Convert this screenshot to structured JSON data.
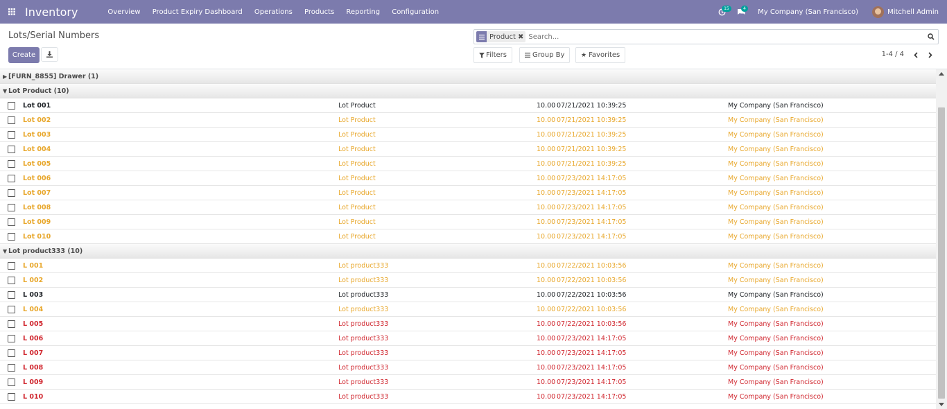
{
  "navbar": {
    "app_title": "Inventory",
    "menu": [
      "Overview",
      "Product Expiry Dashboard",
      "Operations",
      "Products",
      "Reporting",
      "Configuration"
    ],
    "activity_count": "15",
    "messages_count": "4",
    "company": "My Company (San Francisco)",
    "user": "Mitchell Admin"
  },
  "control": {
    "breadcrumb": "Lots/Serial Numbers",
    "create_label": "Create",
    "search_facet": "Product",
    "search_placeholder": "Search...",
    "filters_label": "Filters",
    "groupby_label": "Group By",
    "favorites_label": "Favorites",
    "pager": "1-4 / 4"
  },
  "groups": [
    {
      "label": "[FURN_8855] Drawer (1)",
      "expanded": false
    },
    {
      "label": "Lot Product (10)",
      "expanded": true
    },
    {
      "label": "Lot product333 (10)",
      "expanded": true
    }
  ],
  "group1_rows": [
    {
      "lot": "Lot 001",
      "product": "Lot Product",
      "qty": "10.00",
      "date": "07/21/2021 10:39:25",
      "company": "My Company (San Francisco)",
      "status": "black"
    },
    {
      "lot": "Lot 002",
      "product": "Lot Product",
      "qty": "10.00",
      "date": "07/21/2021 10:39:25",
      "company": "My Company (San Francisco)",
      "status": "orange"
    },
    {
      "lot": "Lot 003",
      "product": "Lot Product",
      "qty": "10.00",
      "date": "07/21/2021 10:39:25",
      "company": "My Company (San Francisco)",
      "status": "orange"
    },
    {
      "lot": "Lot 004",
      "product": "Lot Product",
      "qty": "10.00",
      "date": "07/21/2021 10:39:25",
      "company": "My Company (San Francisco)",
      "status": "orange"
    },
    {
      "lot": "Lot 005",
      "product": "Lot Product",
      "qty": "10.00",
      "date": "07/21/2021 10:39:25",
      "company": "My Company (San Francisco)",
      "status": "orange"
    },
    {
      "lot": "Lot 006",
      "product": "Lot Product",
      "qty": "10.00",
      "date": "07/23/2021 14:17:05",
      "company": "My Company (San Francisco)",
      "status": "orange"
    },
    {
      "lot": "Lot 007",
      "product": "Lot Product",
      "qty": "10.00",
      "date": "07/23/2021 14:17:05",
      "company": "My Company (San Francisco)",
      "status": "orange"
    },
    {
      "lot": "Lot 008",
      "product": "Lot Product",
      "qty": "10.00",
      "date": "07/23/2021 14:17:05",
      "company": "My Company (San Francisco)",
      "status": "orange"
    },
    {
      "lot": "Lot 009",
      "product": "Lot Product",
      "qty": "10.00",
      "date": "07/23/2021 14:17:05",
      "company": "My Company (San Francisco)",
      "status": "orange"
    },
    {
      "lot": "Lot 010",
      "product": "Lot Product",
      "qty": "10.00",
      "date": "07/23/2021 14:17:05",
      "company": "My Company (San Francisco)",
      "status": "orange"
    }
  ],
  "group2_rows": [
    {
      "lot": "L 001",
      "product": "Lot product333",
      "qty": "10.00",
      "date": "07/22/2021 10:03:56",
      "company": "My Company (San Francisco)",
      "status": "orange"
    },
    {
      "lot": "L 002",
      "product": "Lot product333",
      "qty": "10.00",
      "date": "07/22/2021 10:03:56",
      "company": "My Company (San Francisco)",
      "status": "orange"
    },
    {
      "lot": "L 003",
      "product": "Lot product333",
      "qty": "10.00",
      "date": "07/22/2021 10:03:56",
      "company": "My Company (San Francisco)",
      "status": "black"
    },
    {
      "lot": "L 004",
      "product": "Lot product333",
      "qty": "10.00",
      "date": "07/22/2021 10:03:56",
      "company": "My Company (San Francisco)",
      "status": "orange"
    },
    {
      "lot": "L 005",
      "product": "Lot product333",
      "qty": "10.00",
      "date": "07/22/2021 10:03:56",
      "company": "My Company (San Francisco)",
      "status": "red"
    },
    {
      "lot": "L 006",
      "product": "Lot product333",
      "qty": "10.00",
      "date": "07/23/2021 14:17:05",
      "company": "My Company (San Francisco)",
      "status": "red"
    },
    {
      "lot": "L 007",
      "product": "Lot product333",
      "qty": "10.00",
      "date": "07/23/2021 14:17:05",
      "company": "My Company (San Francisco)",
      "status": "red"
    },
    {
      "lot": "L 008",
      "product": "Lot product333",
      "qty": "10.00",
      "date": "07/23/2021 14:17:05",
      "company": "My Company (San Francisco)",
      "status": "red"
    },
    {
      "lot": "L 009",
      "product": "Lot product333",
      "qty": "10.00",
      "date": "07/23/2021 14:17:05",
      "company": "My Company (San Francisco)",
      "status": "red"
    },
    {
      "lot": "L 010",
      "product": "Lot product333",
      "qty": "10.00",
      "date": "07/23/2021 14:17:05",
      "company": "My Company (San Francisco)",
      "status": "red"
    }
  ],
  "colors": {
    "navbar": "#7c7bad",
    "black": "#212529",
    "orange": "#e8a72b",
    "red": "#d0262e"
  }
}
